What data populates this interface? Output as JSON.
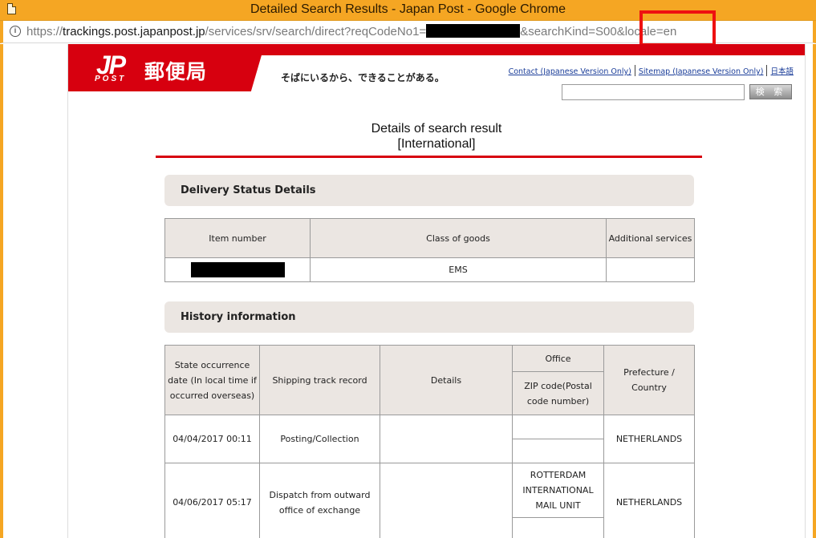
{
  "window": {
    "title": "Detailed Search Results - Japan Post - Google Chrome"
  },
  "address_bar": {
    "scheme": "https://",
    "host": "trackings.post.japanpost.jp",
    "path": "/services/srv/search/direct?reqCodeNo1=",
    "query_tail": "&searchKind=S00",
    "locale_param": "&locale=en"
  },
  "header": {
    "logo_jp": "JP",
    "logo_post": "POST",
    "logo_name": "郵便局",
    "tagline": "そばにいるから、できることがある。",
    "links": {
      "contact": "Contact (Japanese Version Only)",
      "sitemap": "Sitemap (Japanese Version Only)",
      "japanese": "日本語"
    },
    "search_button": "検 索"
  },
  "page": {
    "title_line1": "Details of search result",
    "title_line2": "[International]"
  },
  "delivery_status": {
    "heading": "Delivery Status Details",
    "columns": {
      "item_number": "Item number",
      "class_of_goods": "Class of goods",
      "additional_services": "Additional services"
    },
    "row": {
      "class_of_goods": "EMS",
      "additional_services": ""
    }
  },
  "history": {
    "heading": "History information",
    "columns": {
      "date": "State occurrence date (In local time if occurred overseas)",
      "track_record": "Shipping track record",
      "details": "Details",
      "office": "Office",
      "zip": "ZIP code(Postal code number)",
      "prefecture": "Prefecture / Country"
    },
    "rows": [
      {
        "date": "04/04/2017 00:11",
        "track_record": "Posting/Collection",
        "details": "",
        "office": "",
        "zip": "",
        "prefecture": "NETHERLANDS"
      },
      {
        "date": "04/06/2017 05:17",
        "track_record": "Dispatch from outward office of exchange",
        "details": "",
        "office": "ROTTERDAM INTERNATIONAL MAIL UNIT",
        "zip": "",
        "prefecture": "NETHERLANDS"
      }
    ]
  },
  "colors": {
    "brand_red": "#d7000f",
    "window_frame": "#f5a623",
    "section_bg": "#ebe6e2",
    "highlight": "#ee1111"
  }
}
